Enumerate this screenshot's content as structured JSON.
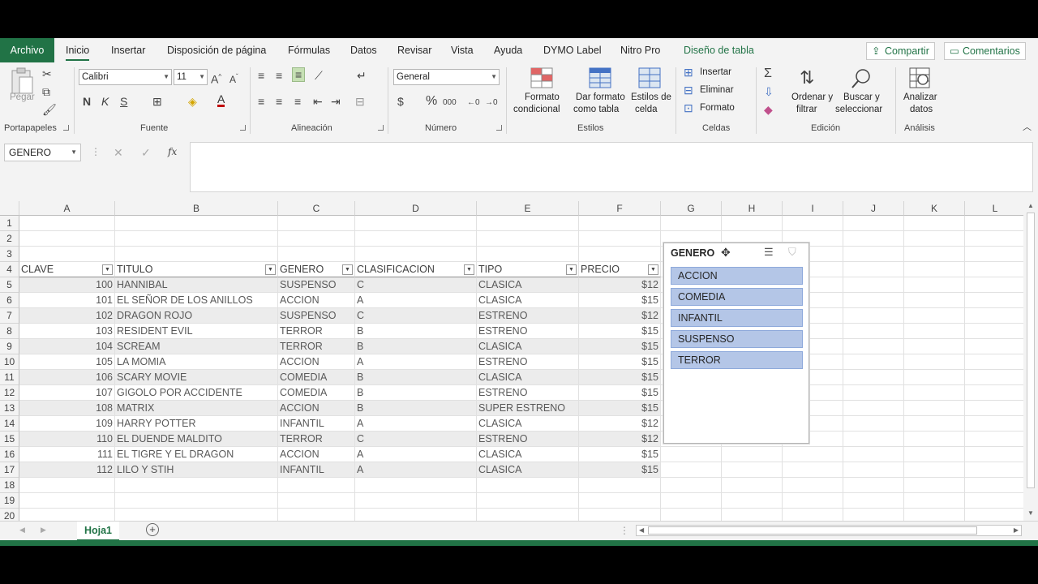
{
  "tabs": {
    "archivo": "Archivo",
    "inicio": "Inicio",
    "insertar": "Insertar",
    "disposicion": "Disposición de página",
    "formulas": "Fórmulas",
    "datos": "Datos",
    "revisar": "Revisar",
    "vista": "Vista",
    "ayuda": "Ayuda",
    "dymo": "DYMO Label",
    "nitro": "Nitro Pro",
    "diseno": "Diseño de tabla",
    "compartir": "Compartir",
    "comentarios": "Comentarios"
  },
  "ribbon": {
    "pegar": "Pegar",
    "portapapeles": "Portapapeles",
    "font_name": "Calibri",
    "font_size": "11",
    "bold": "N",
    "italic": "K",
    "underline": "S",
    "fuente": "Fuente",
    "alineacion": "Alineación",
    "number_format": "General",
    "numero": "Número",
    "formato_cond_1": "Formato",
    "formato_cond_2": "condicional",
    "dar_formato_1": "Dar formato",
    "dar_formato_2": "como tabla",
    "estilos_celda_1": "Estilos de",
    "estilos_celda_2": "celda",
    "estilos": "Estilos",
    "insertar": "Insertar",
    "eliminar": "Eliminar",
    "formato": "Formato",
    "celdas": "Celdas",
    "ordenar_1": "Ordenar y",
    "ordenar_2": "filtrar",
    "buscar_1": "Buscar y",
    "buscar_2": "seleccionar",
    "edicion": "Edición",
    "analizar_1": "Analizar",
    "analizar_2": "datos",
    "analisis": "Análisis"
  },
  "formula_bar": {
    "name_box": "GENERO",
    "fx": "fx",
    "content": ""
  },
  "columns": [
    "A",
    "B",
    "C",
    "D",
    "E",
    "F",
    "G",
    "H",
    "I",
    "J",
    "K",
    "L"
  ],
  "rows": [
    "1",
    "2",
    "3",
    "4",
    "5",
    "6",
    "7",
    "8",
    "9",
    "10",
    "11",
    "12",
    "13",
    "14",
    "15",
    "16",
    "17",
    "18",
    "19",
    "20"
  ],
  "table": {
    "headers": [
      "CLAVE",
      "TITULO",
      "GENERO",
      "CLASIFICACION",
      "TIPO",
      "PRECIO"
    ],
    "rows": [
      [
        "100",
        "HANNIBAL",
        "SUSPENSO",
        "C",
        "CLASICA",
        "$12"
      ],
      [
        "101",
        "EL SEÑOR DE LOS ANILLOS",
        "ACCION",
        "A",
        "CLASICA",
        "$15"
      ],
      [
        "102",
        "DRAGON ROJO",
        "SUSPENSO",
        "C",
        "ESTRENO",
        "$12"
      ],
      [
        "103",
        "RESIDENT EVIL",
        "TERROR",
        "B",
        "ESTRENO",
        "$15"
      ],
      [
        "104",
        "SCREAM",
        "TERROR",
        "B",
        "CLASICA",
        "$15"
      ],
      [
        "105",
        "LA MOMIA",
        "ACCION",
        "A",
        "ESTRENO",
        "$15"
      ],
      [
        "106",
        "SCARY MOVIE",
        "COMEDIA",
        "B",
        "CLASICA",
        "$15"
      ],
      [
        "107",
        "GIGOLO POR ACCIDENTE",
        "COMEDIA",
        "B",
        "ESTRENO",
        "$15"
      ],
      [
        "108",
        "MATRIX",
        "ACCION",
        "B",
        "SUPER ESTRENO",
        "$15"
      ],
      [
        "109",
        "HARRY POTTER",
        "INFANTIL",
        "A",
        "CLASICA",
        "$12"
      ],
      [
        "110",
        "EL DUENDE MALDITO",
        "TERROR",
        "C",
        "ESTRENO",
        "$12"
      ],
      [
        "111",
        "EL TIGRE Y EL DRAGON",
        "ACCION",
        "A",
        "CLASICA",
        "$15"
      ],
      [
        "112",
        "LILO Y STIH",
        "INFANTIL",
        "A",
        "CLASICA",
        "$15"
      ]
    ]
  },
  "slicer": {
    "title": "GENERO",
    "items": [
      "ACCION",
      "COMEDIA",
      "INFANTIL",
      "SUSPENSO",
      "TERROR"
    ]
  },
  "sheets": {
    "active": "Hoja1"
  },
  "colors": {
    "accent": "#217346",
    "slicer_item": "#b4c6e7"
  }
}
